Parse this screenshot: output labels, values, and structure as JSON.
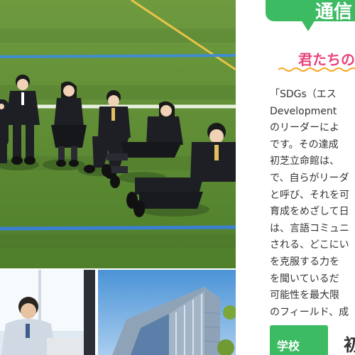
{
  "header": {
    "bubble_text": "通信"
  },
  "section": {
    "heading": "君たちの"
  },
  "article": {
    "lines": [
      "「SDGs（エス",
      "Development",
      "のリーダーによ",
      "です。その達成",
      "初芝立命館は、",
      "で、自らがリーダ",
      "と呼び、それを可",
      "育成をめざして日",
      "は、言語コミュニ",
      "される、どこにい",
      "を克服する力を",
      "を聞いているだ",
      "可能性を最大限",
      "のフィールド、成"
    ]
  },
  "school": {
    "label": "学校",
    "name": "初"
  },
  "colors": {
    "green": "#3dbb63",
    "pink": "#e8457d",
    "orange": "#f5a623"
  }
}
